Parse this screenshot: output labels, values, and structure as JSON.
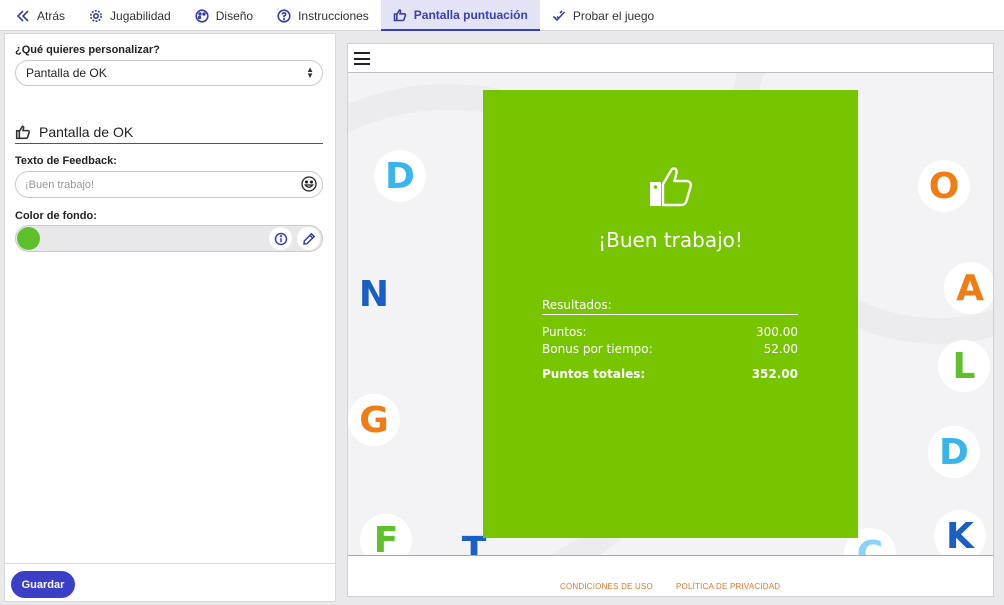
{
  "nav": {
    "items": [
      {
        "label": "Atrás",
        "icon": "back-icon"
      },
      {
        "label": "Jugabilidad",
        "icon": "gear-icon"
      },
      {
        "label": "Diseño",
        "icon": "palette-icon"
      },
      {
        "label": "Instrucciones",
        "icon": "help-icon"
      },
      {
        "label": "Pantalla puntuación",
        "icon": "thumbs-up-icon",
        "active": true
      },
      {
        "label": "Probar el juego",
        "icon": "check-icon"
      }
    ]
  },
  "left": {
    "customize_label": "¿Qué quieres personalizar?",
    "customize_value": "Pantalla de OK",
    "section_title": "Pantalla de OK",
    "feedback_label": "Texto de Feedback:",
    "feedback_placeholder": "¡Buen trabajo!",
    "bg_color_label": "Color de fondo:",
    "bg_color": "#5dbf2a",
    "save_label": "Guardar"
  },
  "preview": {
    "card_color": "#76c500",
    "feedback_text": "¡Buen trabajo!",
    "results_title": "Resultados:",
    "rows": [
      {
        "label": "Puntos:",
        "value": "300.00"
      },
      {
        "label": "Bonus por tiempo:",
        "value": "52.00"
      }
    ],
    "total": {
      "label": "Puntos totales:",
      "value": "352.00"
    },
    "footer": {
      "terms": "CONDICIONES DE USO",
      "privacy": "POLÍTICA DE PRIVACIDAD"
    },
    "letters": [
      "D",
      "N",
      "G",
      "F",
      "T",
      "O",
      "A",
      "L",
      "D",
      "C",
      "K"
    ]
  }
}
